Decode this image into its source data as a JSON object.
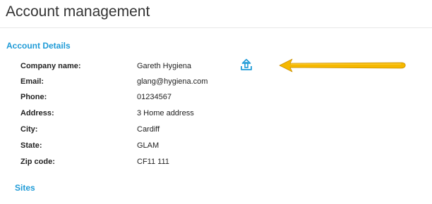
{
  "page": {
    "title": "Account management"
  },
  "account_details": {
    "heading": "Account Details",
    "fields": [
      {
        "label": "Company name:",
        "value": "Gareth Hygiena"
      },
      {
        "label": "Email:",
        "value": "glang@hygiena.com"
      },
      {
        "label": "Phone:",
        "value": "01234567"
      },
      {
        "label": "Address:",
        "value": "3 Home address"
      },
      {
        "label": "City:",
        "value": "Cardiff"
      },
      {
        "label": "State:",
        "value": "GLAM"
      },
      {
        "label": "Zip code:",
        "value": "CF11 111"
      }
    ]
  },
  "sites": {
    "heading": "Sites"
  },
  "icons": {
    "upload": "upload-icon",
    "arrow": "arrow-annotation"
  },
  "colors": {
    "heading_blue": "#1f9bd7",
    "arrow_yellow": "#f5b800",
    "text": "#222222"
  }
}
